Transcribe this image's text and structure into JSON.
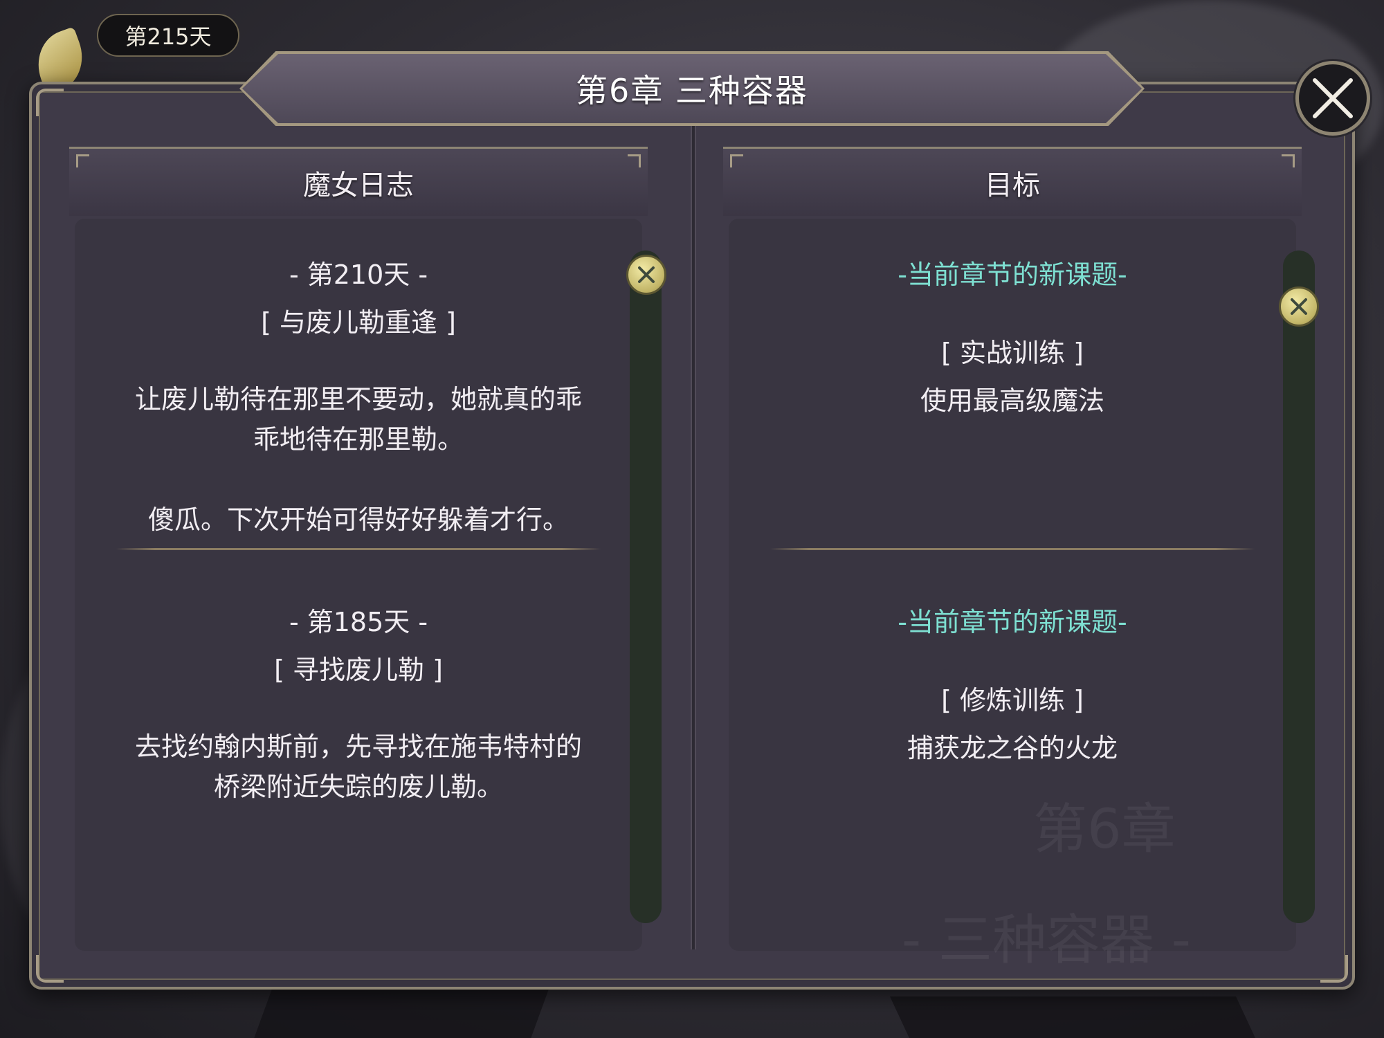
{
  "hud": {
    "day_counter": "第215天"
  },
  "chapter": {
    "title": "第6章  三种容器"
  },
  "journal": {
    "header": "魔女日志",
    "entries": [
      {
        "day": "- 第210天 -",
        "subtitle": "[ 与废儿勒重逢 ]",
        "text_lines": [
          "让废儿勒待在那里不要动，她就真的乖",
          "乖地待在那里勒。"
        ],
        "text2": "傻瓜。下次开始可得好好躲着才行。"
      },
      {
        "day": "- 第185天 -",
        "subtitle": "[ 寻找废儿勒 ]",
        "text_lines": [
          "去找约翰内斯前，先寻找在施韦特村的",
          "桥梁附近失踪的废儿勒。"
        ]
      }
    ]
  },
  "objectives": {
    "header": "目标",
    "items": [
      {
        "heading": "-当前章节的新课题-",
        "name": "[ 实战训练 ]",
        "desc": "使用最高级魔法"
      },
      {
        "heading": "-当前章节的新课题-",
        "name": "[ 修炼训练 ]",
        "desc": "捕获龙之谷的火龙"
      }
    ],
    "watermark_chapter": "第6章",
    "watermark_title": "- 三种容器 -"
  },
  "colors": {
    "accent_teal": "#7ee0d2",
    "frame_gold": "#8d8574",
    "panel_bg": "#393541"
  }
}
